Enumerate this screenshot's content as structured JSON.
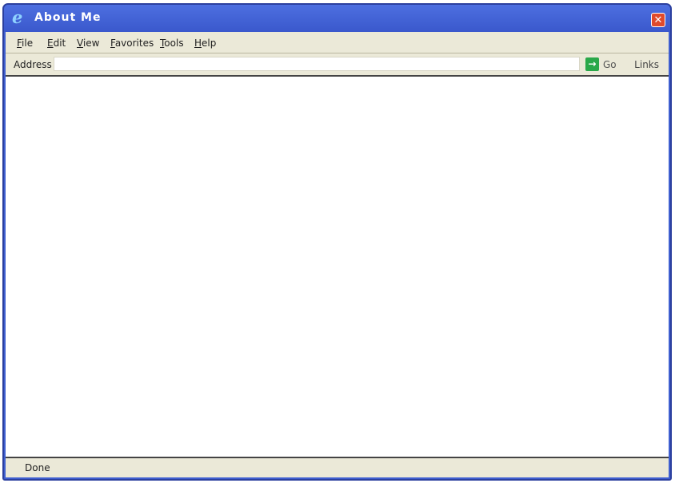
{
  "window": {
    "title": "About Me",
    "close_glyph": "✕",
    "title_icon_glyph": "e"
  },
  "menu": {
    "items": [
      "File",
      "Edit",
      "View",
      "Favorites",
      "Tools",
      "Help"
    ]
  },
  "address_bar": {
    "label": "Address",
    "value": "",
    "go_label": "Go",
    "go_arrow_glyph": "→",
    "links_label": "Links"
  },
  "status_bar": {
    "text": "Done"
  },
  "icons": {
    "title": "internet-explorer-icon",
    "close": "close-icon",
    "go": "arrow-right-icon"
  },
  "colors": {
    "titlebar": "#3f5fd0",
    "chrome": "#ebe9d8",
    "close": "#e04a2c",
    "go": "#2aa84a"
  }
}
